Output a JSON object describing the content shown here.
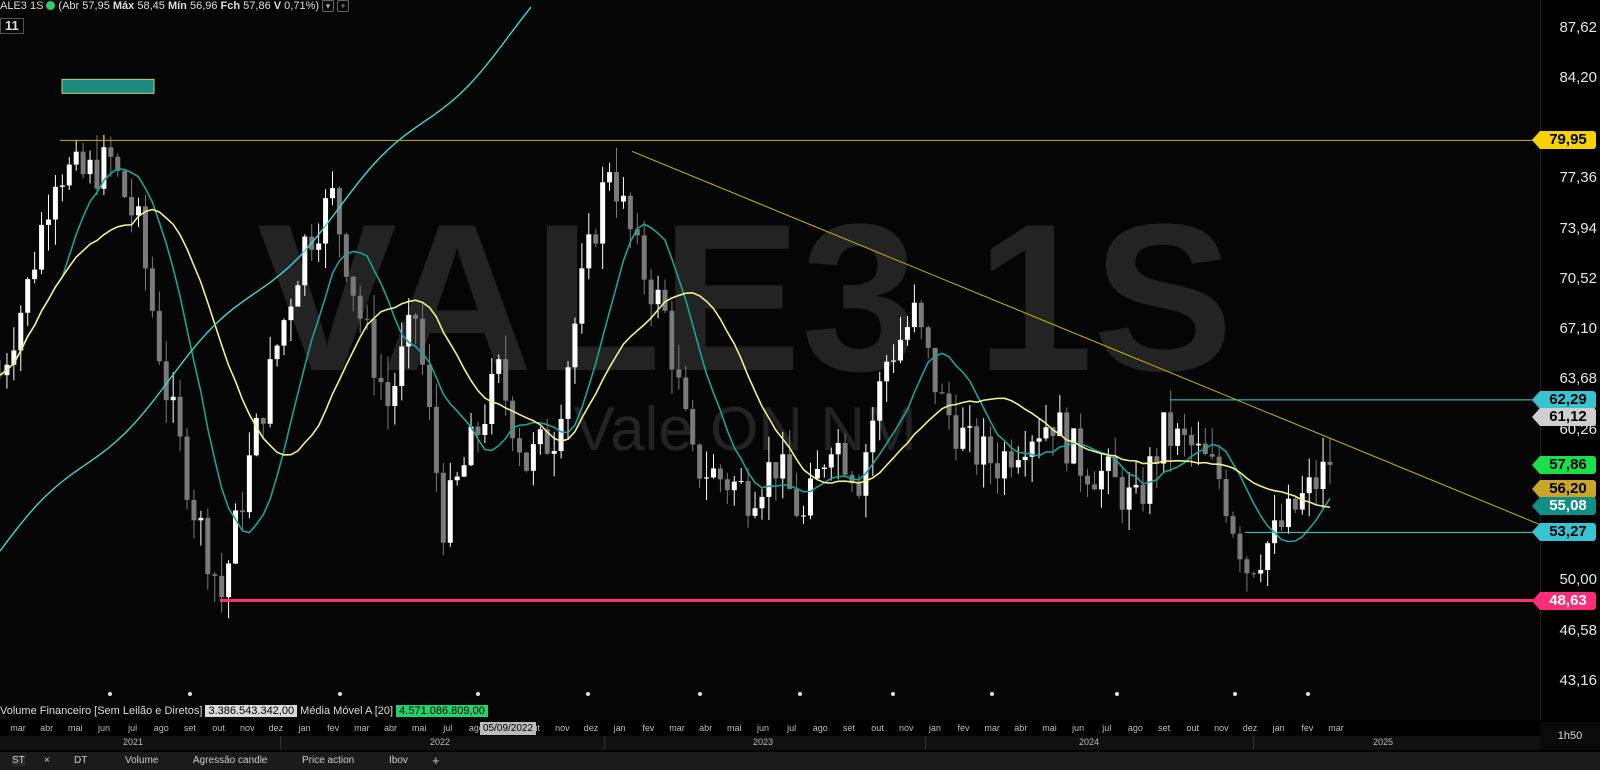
{
  "header": {
    "ticker": "ALE3 1S",
    "open_label": "Abr",
    "open": "57,95",
    "high_label": "Máx",
    "high": "58,45",
    "low_label": "Mín",
    "low": "56,96",
    "close_label": "Fch",
    "close": "57,86",
    "var_label": "V",
    "var": "0,71%",
    "period_box": "11"
  },
  "watermark": {
    "ticker": "VALE3 1S",
    "name": "Vale ON NM"
  },
  "volume_panel": {
    "label": "Volume Financeiro [Sem Leilão e Diretos]",
    "value": "3.386.543.342,00",
    "ma_label": "Média Móvel A [20]",
    "ma_value": "4.571.086.809,00"
  },
  "crosshair_date": "05/09/2022",
  "timeframe": "1h50",
  "tabs": [
    "ST",
    "DT",
    "Volume",
    "Agressão candle",
    "Price action",
    "Ibov"
  ],
  "tab_close": "×",
  "tab_add": "+",
  "colors": {
    "up": "#ffffff",
    "down": "#7a7a7a",
    "ma_long": "#f3f08a",
    "ma_mid": "#1aa39a",
    "ma_fast": "#3bd8d2",
    "resistance": "#c8b400",
    "support": "#ff2d78",
    "zone": "#1c8a80"
  },
  "chart_data": {
    "type": "candlestick",
    "ylim": [
      40.5,
      89.5
    ],
    "y_ticks": [
      "87,62",
      "84,20",
      "77,36",
      "73,94",
      "70,52",
      "67,10",
      "63,68",
      "60,26",
      "50,00",
      "46,58",
      "43,16"
    ],
    "price_labels": [
      {
        "text": "79,95",
        "value": 79.95,
        "bg": "#f5d300",
        "fg": "#000000"
      },
      {
        "text": "62,29",
        "value": 62.29,
        "bg": "#37c4d2",
        "fg": "#000000"
      },
      {
        "text": "61,12",
        "value": 61.12,
        "bg": "#cfcfcf",
        "fg": "#000000"
      },
      {
        "text": "57,86",
        "value": 57.86,
        "bg": "#19e04a",
        "fg": "#000000"
      },
      {
        "text": "56,20",
        "value": 56.2,
        "bg": "#c9a52a",
        "fg": "#000000"
      },
      {
        "text": "55,08",
        "value": 55.08,
        "bg": "#0f8f86",
        "fg": "#ffffff"
      },
      {
        "text": "53,27",
        "value": 53.27,
        "bg": "#37c4d2",
        "fg": "#000000"
      },
      {
        "text": "48,63",
        "value": 48.63,
        "bg": "#ff2d78",
        "fg": "#ffffff"
      }
    ],
    "x_months": [
      "mar",
      "abr",
      "mai",
      "jun",
      "jul",
      "ago",
      "set",
      "out",
      "nov",
      "dez",
      "jan",
      "fev",
      "mar",
      "abr",
      "mai",
      "jul",
      "ago",
      "set",
      "out",
      "nov",
      "dez",
      "jan",
      "fev",
      "mar",
      "abr",
      "mai",
      "jun",
      "jul",
      "ago",
      "set",
      "out",
      "nov",
      "jan",
      "fev",
      "mar",
      "abr",
      "mai",
      "jun",
      "jul",
      "ago",
      "set",
      "out",
      "nov",
      "dez",
      "jan",
      "fev",
      "mar"
    ],
    "x_years": [
      "2021",
      "2022",
      "2023",
      "2024",
      "2025"
    ],
    "weekly_close_path": [
      [
        "2021-03",
        64
      ],
      [
        "2021-04",
        70
      ],
      [
        "2021-05",
        78
      ],
      [
        "2021-06",
        77.5
      ],
      [
        "2021-07",
        78.5
      ],
      [
        "2021-08",
        74
      ],
      [
        "2021-09",
        63
      ],
      [
        "2021-10",
        55
      ],
      [
        "2021-11",
        49
      ],
      [
        "2021-12",
        58
      ],
      [
        "2022-01",
        66
      ],
      [
        "2022-02",
        73
      ],
      [
        "2022-03",
        76
      ],
      [
        "2022-04",
        68
      ],
      [
        "2022-05",
        62
      ],
      [
        "2022-06",
        68
      ],
      [
        "2022-07",
        54
      ],
      [
        "2022-08",
        59
      ],
      [
        "2022-09",
        64
      ],
      [
        "2022-10",
        58
      ],
      [
        "2022-11",
        60
      ],
      [
        "2022-12",
        70
      ],
      [
        "2023-01",
        78.5
      ],
      [
        "2023-02",
        72
      ],
      [
        "2023-03",
        68
      ],
      [
        "2023-04",
        58
      ],
      [
        "2023-05",
        57
      ],
      [
        "2023-06",
        56
      ],
      [
        "2023-07",
        58
      ],
      [
        "2023-08",
        54
      ],
      [
        "2023-09",
        60
      ],
      [
        "2023-10",
        57
      ],
      [
        "2023-11",
        65
      ],
      [
        "2023-12",
        68
      ],
      [
        "2024-01",
        62
      ],
      [
        "2024-02",
        59
      ],
      [
        "2024-03",
        58
      ],
      [
        "2024-04",
        60
      ],
      [
        "2024-05",
        61
      ],
      [
        "2024-06",
        58
      ],
      [
        "2024-07",
        57
      ],
      [
        "2024-08",
        55
      ],
      [
        "2024-09",
        60
      ],
      [
        "2024-10",
        59
      ],
      [
        "2024-11",
        57
      ],
      [
        "2024-12",
        51
      ],
      [
        "2025-01",
        53
      ],
      [
        "2025-02",
        55.5
      ],
      [
        "2025-03",
        57.86
      ]
    ]
  }
}
